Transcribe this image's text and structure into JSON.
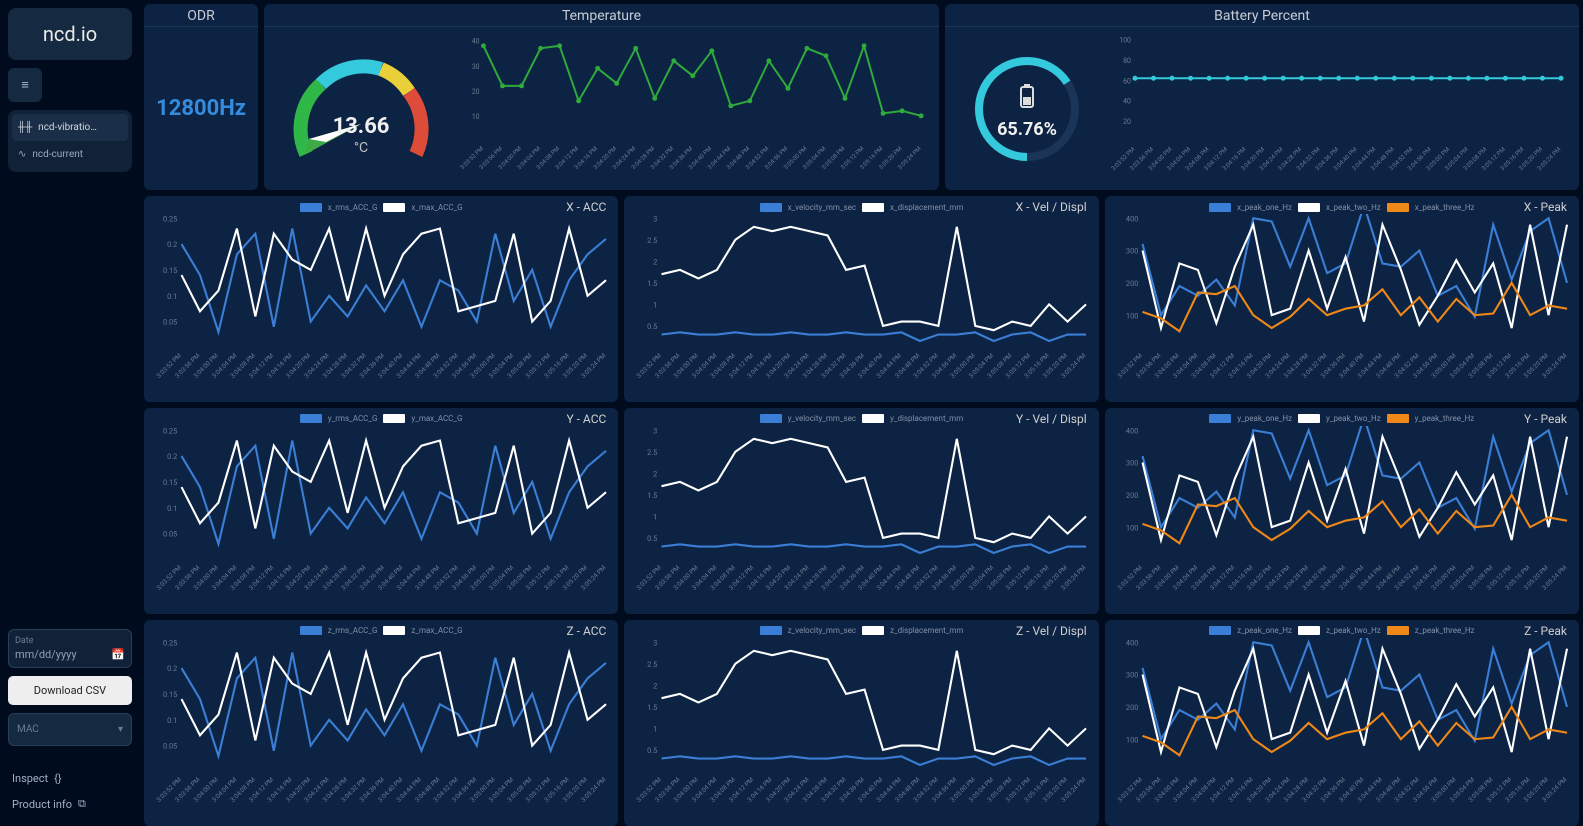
{
  "sidebar": {
    "logo": "ncd.io",
    "nav": [
      {
        "label": "ncd-vibratio…",
        "icon": "waveform"
      },
      {
        "label": "ncd-current",
        "icon": "pulse"
      }
    ],
    "date_label": "Date",
    "date_placeholder": "mm/dd/yyyy",
    "download": "Download CSV",
    "mac_label": "MAC",
    "inspect": "Inspect",
    "product": "Product info"
  },
  "odr": {
    "title": "ODR",
    "value": "12800Hz"
  },
  "temperature": {
    "title": "Temperature",
    "value": "13.66",
    "unit": "°C"
  },
  "battery": {
    "title": "Battery Percent",
    "value": "65.76%"
  },
  "time_labels": [
    "3:03:52 PM",
    "3:03:56 PM",
    "3:04:00 PM",
    "3:04:04 PM",
    "3:04:08 PM",
    "3:04:12 PM",
    "3:04:16 PM",
    "3:04:20 PM",
    "3:04:24 PM",
    "3:04:28 PM",
    "3:04:32 PM",
    "3:04:36 PM",
    "3:04:40 PM",
    "3:04:44 PM",
    "3:04:48 PM",
    "3:04:52 PM",
    "3:04:56 PM",
    "3:05:00 PM",
    "3:05:04 PM",
    "3:05:08 PM",
    "3:05:12 PM",
    "3:05:16 PM",
    "3:05:20 PM",
    "3:05:24 PM"
  ],
  "chart_data": [
    {
      "id": "temp_line",
      "type": "line",
      "ylim": [
        0,
        40
      ],
      "yticks": [
        10,
        20,
        30,
        40
      ],
      "series": [
        {
          "name": "temp",
          "color": "#2eab3c",
          "values": [
            38,
            22,
            22,
            37,
            38,
            16,
            29,
            23,
            37,
            17,
            32,
            26,
            36,
            14,
            16,
            32,
            21,
            37,
            34,
            17,
            38,
            11,
            12,
            10
          ]
        }
      ]
    },
    {
      "id": "bat_line",
      "type": "line",
      "ylim": [
        0,
        100
      ],
      "yticks": [
        20,
        40,
        60,
        80,
        100
      ],
      "series": [
        {
          "name": "bat",
          "color": "#35c9dd",
          "values": [
            62,
            62,
            62,
            62,
            62,
            62,
            62,
            62,
            62,
            62,
            62,
            62,
            62,
            62,
            62,
            62,
            62,
            62,
            62,
            62,
            62,
            62,
            62,
            62
          ]
        }
      ]
    },
    {
      "id": "x_acc",
      "title": "X - ACC",
      "type": "line",
      "ylim": [
        0,
        0.25
      ],
      "yticks": [
        0.05,
        0.1,
        0.15,
        0.2,
        0.25
      ],
      "series": [
        {
          "name": "x_rms_ACC_G",
          "color": "#3a7fd5",
          "values": [
            0.2,
            0.14,
            0.03,
            0.18,
            0.22,
            0.04,
            0.23,
            0.05,
            0.1,
            0.06,
            0.12,
            0.07,
            0.13,
            0.04,
            0.13,
            0.11,
            0.05,
            0.22,
            0.09,
            0.15,
            0.04,
            0.13,
            0.18,
            0.21
          ]
        },
        {
          "name": "x_max_ACC_G",
          "color": "#ffffff",
          "values": [
            0.14,
            0.07,
            0.11,
            0.23,
            0.06,
            0.22,
            0.17,
            0.15,
            0.23,
            0.09,
            0.23,
            0.1,
            0.18,
            0.22,
            0.23,
            0.07,
            0.08,
            0.09,
            0.22,
            0.05,
            0.09,
            0.23,
            0.1,
            0.13
          ]
        }
      ]
    },
    {
      "id": "x_vel",
      "title": "X - Vel / Displ",
      "type": "line",
      "ylim": [
        0,
        3.0
      ],
      "yticks": [
        0.5,
        1.0,
        1.5,
        2.0,
        2.5,
        3.0
      ],
      "series": [
        {
          "name": "x_velocity_mm_sec",
          "color": "#3a7fd5",
          "values": [
            0.3,
            0.35,
            0.3,
            0.3,
            0.35,
            0.3,
            0.3,
            0.35,
            0.3,
            0.3,
            0.35,
            0.3,
            0.3,
            0.35,
            0.15,
            0.3,
            0.3,
            0.35,
            0.15,
            0.3,
            0.35,
            0.15,
            0.3,
            0.3
          ]
        },
        {
          "name": "x_displacement_mm",
          "color": "#ffffff",
          "values": [
            1.7,
            1.8,
            1.6,
            1.8,
            2.5,
            2.8,
            2.7,
            2.8,
            2.7,
            2.6,
            1.8,
            1.9,
            0.5,
            0.6,
            0.6,
            0.5,
            2.8,
            0.5,
            0.4,
            0.6,
            0.5,
            1.0,
            0.6,
            1.0
          ]
        }
      ]
    },
    {
      "id": "x_peak",
      "title": "X - Peak",
      "type": "line",
      "ylim": [
        0,
        400
      ],
      "yticks": [
        100,
        200,
        300,
        400
      ],
      "series": [
        {
          "name": "x_peak_one_Hz",
          "color": "#3a7fd5",
          "values": [
            320,
            100,
            190,
            160,
            210,
            130,
            400,
            390,
            250,
            400,
            230,
            260,
            440,
            260,
            250,
            300,
            160,
            190,
            95,
            380,
            210,
            360,
            400,
            200
          ]
        },
        {
          "name": "x_peak_two_Hz",
          "color": "#ffffff",
          "values": [
            300,
            60,
            260,
            240,
            75,
            250,
            380,
            100,
            120,
            300,
            120,
            280,
            80,
            380,
            240,
            70,
            160,
            270,
            170,
            260,
            60,
            380,
            100,
            380
          ]
        },
        {
          "name": "x_peak_three_Hz",
          "color": "#ee8818",
          "values": [
            110,
            90,
            50,
            170,
            165,
            190,
            100,
            60,
            95,
            150,
            100,
            120,
            130,
            180,
            100,
            155,
            80,
            150,
            100,
            105,
            200,
            100,
            130,
            120
          ]
        }
      ]
    },
    {
      "id": "y_acc",
      "title": "Y - ACC",
      "type": "line",
      "ylim": [
        0,
        0.25
      ],
      "yticks": [
        0.05,
        0.1,
        0.15,
        0.2,
        0.25
      ],
      "series": [
        {
          "name": "y_rms_ACC_G",
          "color": "#3a7fd5",
          "values": [
            0.2,
            0.14,
            0.03,
            0.18,
            0.22,
            0.04,
            0.23,
            0.05,
            0.1,
            0.06,
            0.12,
            0.07,
            0.13,
            0.04,
            0.13,
            0.11,
            0.05,
            0.22,
            0.09,
            0.15,
            0.04,
            0.13,
            0.18,
            0.21
          ]
        },
        {
          "name": "y_max_ACC_G",
          "color": "#ffffff",
          "values": [
            0.14,
            0.07,
            0.11,
            0.23,
            0.06,
            0.22,
            0.17,
            0.15,
            0.23,
            0.09,
            0.23,
            0.1,
            0.18,
            0.22,
            0.23,
            0.07,
            0.08,
            0.09,
            0.22,
            0.05,
            0.09,
            0.23,
            0.1,
            0.13
          ]
        }
      ]
    },
    {
      "id": "y_vel",
      "title": "Y - Vel / Displ",
      "type": "line",
      "ylim": [
        0,
        3.0
      ],
      "yticks": [
        0.5,
        1.0,
        1.5,
        2.0,
        2.5,
        3.0
      ],
      "series": [
        {
          "name": "y_velocity_mm_sec",
          "color": "#3a7fd5",
          "values": [
            0.3,
            0.35,
            0.3,
            0.3,
            0.35,
            0.3,
            0.3,
            0.35,
            0.3,
            0.3,
            0.35,
            0.3,
            0.3,
            0.35,
            0.15,
            0.3,
            0.3,
            0.35,
            0.15,
            0.3,
            0.35,
            0.15,
            0.3,
            0.3
          ]
        },
        {
          "name": "y_displacement_mm",
          "color": "#ffffff",
          "values": [
            1.7,
            1.8,
            1.6,
            1.8,
            2.5,
            2.8,
            2.7,
            2.8,
            2.7,
            2.6,
            1.8,
            1.9,
            0.5,
            0.6,
            0.6,
            0.5,
            2.8,
            0.5,
            0.4,
            0.6,
            0.5,
            1.0,
            0.6,
            1.0
          ]
        }
      ]
    },
    {
      "id": "y_peak",
      "title": "Y - Peak",
      "type": "line",
      "ylim": [
        0,
        400
      ],
      "yticks": [
        100,
        200,
        300,
        400
      ],
      "series": [
        {
          "name": "y_peak_one_Hz",
          "color": "#3a7fd5",
          "values": [
            320,
            100,
            190,
            160,
            210,
            130,
            400,
            390,
            250,
            400,
            230,
            260,
            440,
            260,
            250,
            300,
            160,
            190,
            95,
            380,
            210,
            360,
            400,
            200
          ]
        },
        {
          "name": "y_peak_two_Hz",
          "color": "#ffffff",
          "values": [
            300,
            60,
            260,
            240,
            75,
            250,
            380,
            100,
            120,
            300,
            120,
            280,
            80,
            380,
            240,
            70,
            160,
            270,
            170,
            260,
            60,
            380,
            100,
            380
          ]
        },
        {
          "name": "y_peak_three_Hz",
          "color": "#ee8818",
          "values": [
            110,
            90,
            50,
            170,
            165,
            190,
            100,
            60,
            95,
            150,
            100,
            120,
            130,
            180,
            100,
            155,
            80,
            150,
            100,
            105,
            200,
            100,
            130,
            120
          ]
        }
      ]
    },
    {
      "id": "z_acc",
      "title": "Z - ACC",
      "type": "line",
      "ylim": [
        0,
        0.25
      ],
      "yticks": [
        0.05,
        0.1,
        0.15,
        0.2,
        0.25
      ],
      "series": [
        {
          "name": "z_rms_ACC_G",
          "color": "#3a7fd5",
          "values": [
            0.2,
            0.14,
            0.03,
            0.18,
            0.22,
            0.04,
            0.23,
            0.05,
            0.1,
            0.06,
            0.12,
            0.07,
            0.13,
            0.04,
            0.13,
            0.11,
            0.05,
            0.22,
            0.09,
            0.15,
            0.04,
            0.13,
            0.18,
            0.21
          ]
        },
        {
          "name": "z_max_ACC_G",
          "color": "#ffffff",
          "values": [
            0.14,
            0.07,
            0.11,
            0.23,
            0.06,
            0.22,
            0.17,
            0.15,
            0.23,
            0.09,
            0.23,
            0.1,
            0.18,
            0.22,
            0.23,
            0.07,
            0.08,
            0.09,
            0.22,
            0.05,
            0.09,
            0.23,
            0.1,
            0.13
          ]
        }
      ]
    },
    {
      "id": "z_vel",
      "title": "Z - Vel / Displ",
      "type": "line",
      "ylim": [
        0,
        3.0
      ],
      "yticks": [
        0.5,
        1.0,
        1.5,
        2.0,
        2.5,
        3.0
      ],
      "series": [
        {
          "name": "z_velocity_mm_sec",
          "color": "#3a7fd5",
          "values": [
            0.3,
            0.35,
            0.3,
            0.3,
            0.35,
            0.3,
            0.3,
            0.35,
            0.3,
            0.3,
            0.35,
            0.3,
            0.3,
            0.35,
            0.15,
            0.3,
            0.3,
            0.35,
            0.15,
            0.3,
            0.35,
            0.15,
            0.3,
            0.3
          ]
        },
        {
          "name": "z_displacement_mm",
          "color": "#ffffff",
          "values": [
            1.7,
            1.8,
            1.6,
            1.8,
            2.5,
            2.8,
            2.7,
            2.8,
            2.7,
            2.6,
            1.8,
            1.9,
            0.5,
            0.6,
            0.6,
            0.5,
            2.8,
            0.5,
            0.4,
            0.6,
            0.5,
            1.0,
            0.6,
            1.0
          ]
        }
      ]
    },
    {
      "id": "z_peak",
      "title": "Z - Peak",
      "type": "line",
      "ylim": [
        0,
        400
      ],
      "yticks": [
        100,
        200,
        300,
        400
      ],
      "series": [
        {
          "name": "z_peak_one_Hz",
          "color": "#3a7fd5",
          "values": [
            320,
            100,
            190,
            160,
            210,
            130,
            400,
            390,
            250,
            400,
            230,
            260,
            440,
            260,
            250,
            300,
            160,
            190,
            95,
            380,
            210,
            360,
            400,
            200
          ]
        },
        {
          "name": "z_peak_two_Hz",
          "color": "#ffffff",
          "values": [
            300,
            60,
            260,
            240,
            75,
            250,
            380,
            100,
            120,
            300,
            120,
            280,
            80,
            380,
            240,
            70,
            160,
            270,
            170,
            260,
            60,
            380,
            100,
            380
          ]
        },
        {
          "name": "z_peak_three_Hz",
          "color": "#ee8818",
          "values": [
            110,
            90,
            50,
            170,
            165,
            190,
            100,
            60,
            95,
            150,
            100,
            120,
            130,
            180,
            100,
            155,
            80,
            150,
            100,
            105,
            200,
            100,
            130,
            120
          ]
        }
      ]
    }
  ]
}
